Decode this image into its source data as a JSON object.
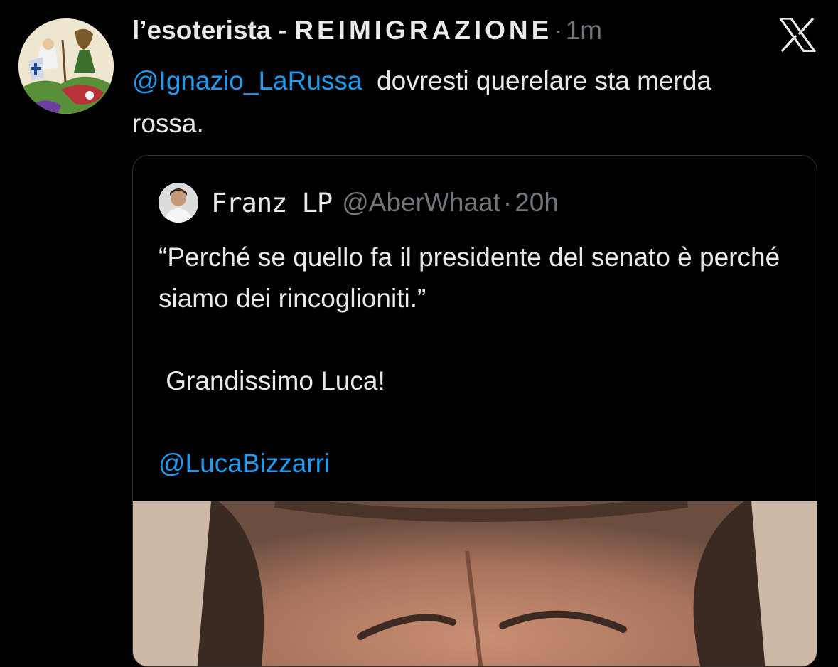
{
  "tweet": {
    "display_name_prefix": "l’esoterista - ",
    "display_name_spaced": "REIMIGRAZIONE",
    "dot": "·",
    "time": "1m",
    "mention": "@Ignazio_LaRussa",
    "text_rest": "  dovresti querelare sta merda rossa."
  },
  "quoted_tweet": {
    "display_name": "Franz LP",
    "handle": "@AberWhaat",
    "dot": "·",
    "time": "20h",
    "line1": "“Perché se quello fa il presidente del senato è perché siamo dei rincoglioniti.”",
    "line2": " Grandissimo Luca!",
    "mention": "@LucaBizzarri"
  },
  "icons": {
    "brand": "x-logo-icon",
    "avatar": "avatar-image",
    "quoted_avatar": "quoted-avatar-image",
    "media": "video-thumbnail"
  },
  "colors": {
    "background": "#000000",
    "text": "#e7e9ea",
    "muted": "#71767b",
    "link": "#1d9bf0",
    "border": "#2f3336"
  }
}
